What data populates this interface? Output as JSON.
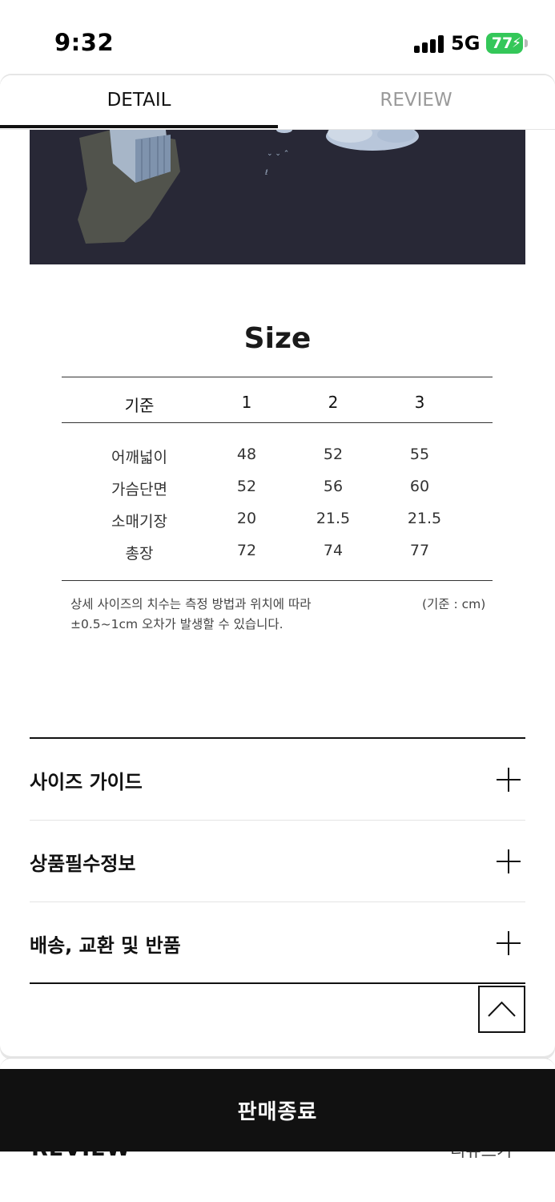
{
  "status_bar": {
    "time": "9:32",
    "network": "5G",
    "battery": "77"
  },
  "tabs": [
    {
      "label": "DETAIL",
      "active": true
    },
    {
      "label": "REVIEW",
      "active": false
    }
  ],
  "size_section": {
    "title": "Size",
    "headers": [
      "기준",
      "1",
      "2",
      "3"
    ],
    "rows": [
      [
        "어깨넓이",
        "48",
        "52",
        "55"
      ],
      [
        "가슴단면",
        "52",
        "56",
        "60"
      ],
      [
        "소매기장",
        "20",
        "21.5",
        "21.5"
      ],
      [
        "총장",
        "72",
        "74",
        "77"
      ]
    ],
    "note_line1": "상세 사이즈의 치수는 측정 방법과 위치에 따라",
    "note_line2": "±0.5~1cm 오차가 발생할 수 있습니다.",
    "unit": "(기준 : cm)"
  },
  "accordion": [
    {
      "label": "사이즈 가이드",
      "icon": "plus-icon"
    },
    {
      "label": "상품필수정보",
      "icon": "plus-icon"
    },
    {
      "label": "배송, 교환 및 반품",
      "icon": "plus-icon"
    }
  ],
  "scroll_top_icon": "chevron-up-icon",
  "bottom": {
    "sold_out_label": "판매종료",
    "review_heading": "REVIEW",
    "review_write": "리뷰쓰기"
  },
  "colors": {
    "battery": "#34c759",
    "dark": "#111111",
    "product_fabric": "#262633"
  }
}
